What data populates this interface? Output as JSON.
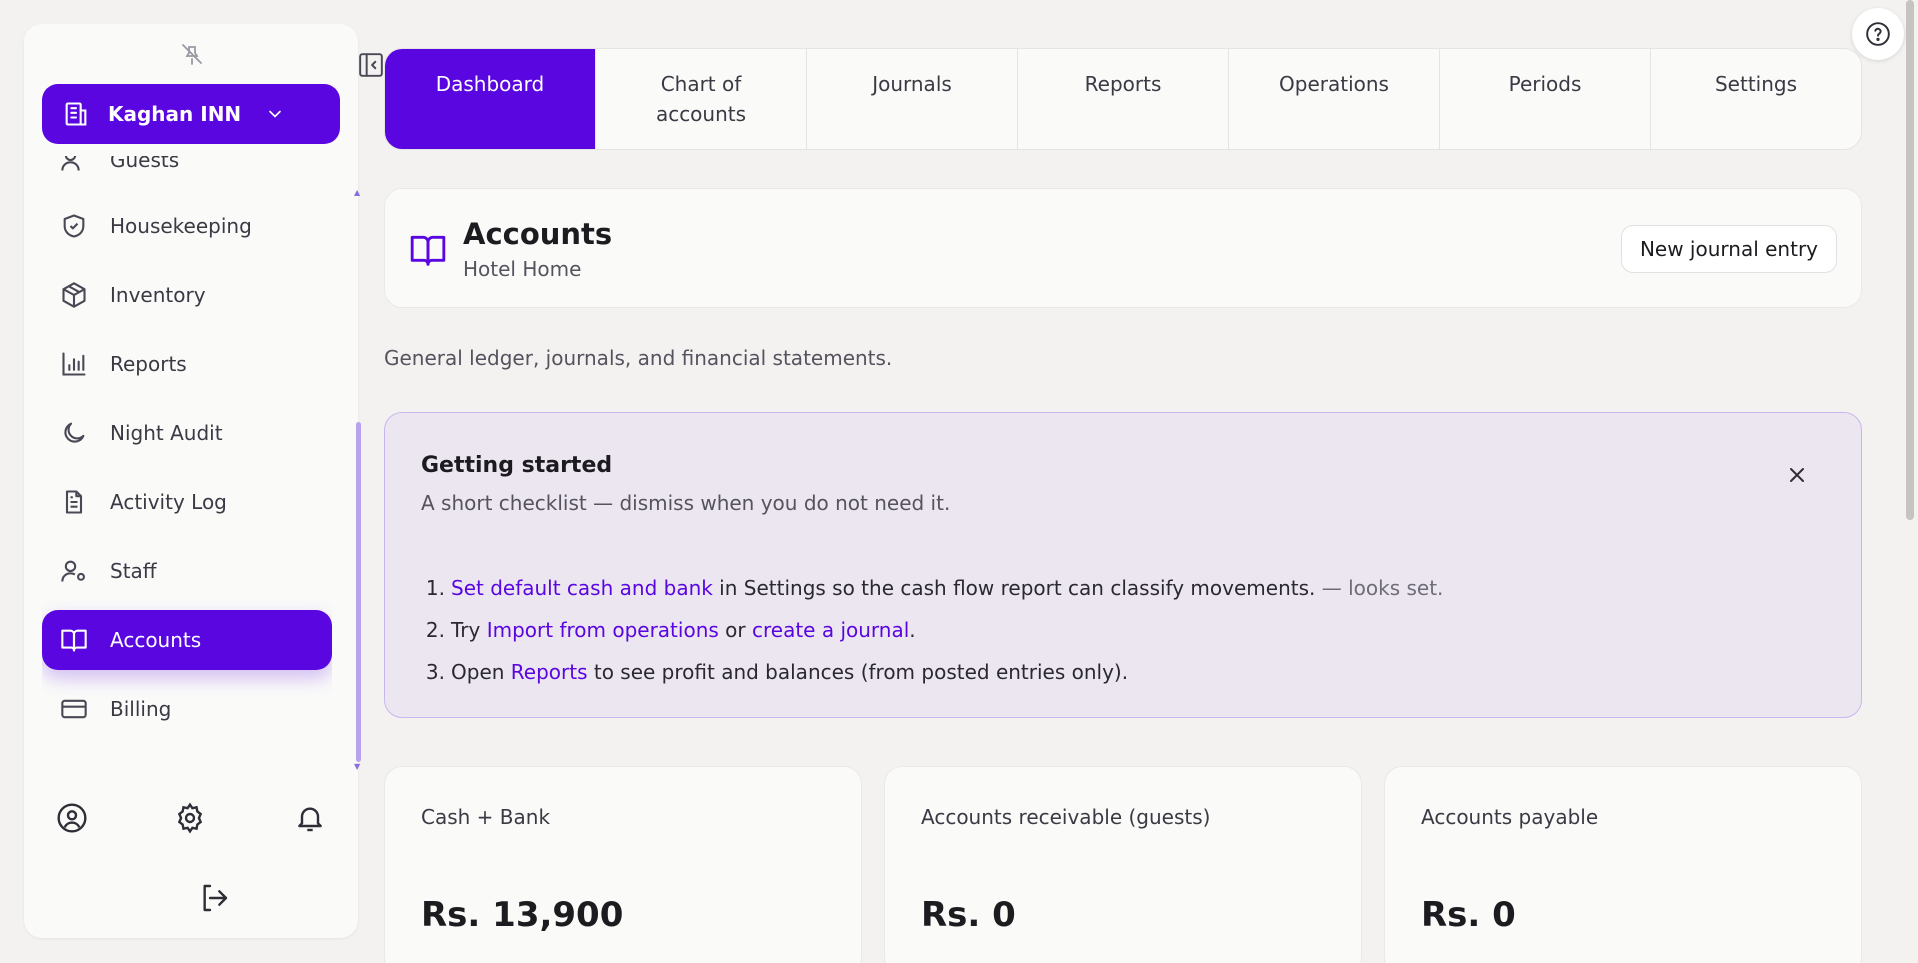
{
  "org": {
    "name": "Kaghan INN"
  },
  "sidebar": {
    "items": [
      {
        "label": "Guests"
      },
      {
        "label": "Housekeeping"
      },
      {
        "label": "Inventory"
      },
      {
        "label": "Reports"
      },
      {
        "label": "Night Audit"
      },
      {
        "label": "Activity Log"
      },
      {
        "label": "Staff"
      },
      {
        "label": "Accounts",
        "active": true
      },
      {
        "label": "Billing"
      }
    ]
  },
  "tabs": [
    {
      "label": "Dashboard",
      "active": true
    },
    {
      "label": "Chart of accounts"
    },
    {
      "label": "Journals"
    },
    {
      "label": "Reports"
    },
    {
      "label": "Operations"
    },
    {
      "label": "Periods"
    },
    {
      "label": "Settings"
    }
  ],
  "header": {
    "title": "Accounts",
    "subtitle": "Hotel Home",
    "new_entry_label": "New journal entry"
  },
  "description": "General ledger, journals, and financial statements.",
  "getting_started": {
    "title": "Getting started",
    "subtitle": "A short checklist — dismiss when you do not need it.",
    "step1": {
      "num": "1.",
      "link": "Set default cash and bank",
      "text": " in Settings so the cash flow report can classify movements.",
      "note": " — looks set."
    },
    "step2": {
      "num": "2.",
      "pre": "Try ",
      "link1": "Import from operations",
      "mid": " or ",
      "link2": "create a journal",
      "post": "."
    },
    "step3": {
      "num": "3.",
      "pre": "Open ",
      "link": "Reports",
      "post": " to see profit and balances (from posted entries only)."
    }
  },
  "stats": [
    {
      "label": "Cash + Bank",
      "value": "Rs. 13,900"
    },
    {
      "label": "Accounts receivable (guests)",
      "value": "Rs. 0"
    },
    {
      "label": "Accounts payable",
      "value": "Rs. 0"
    }
  ],
  "colors": {
    "accent": "#5a06e0",
    "banner_bg": "#ece6f1"
  }
}
